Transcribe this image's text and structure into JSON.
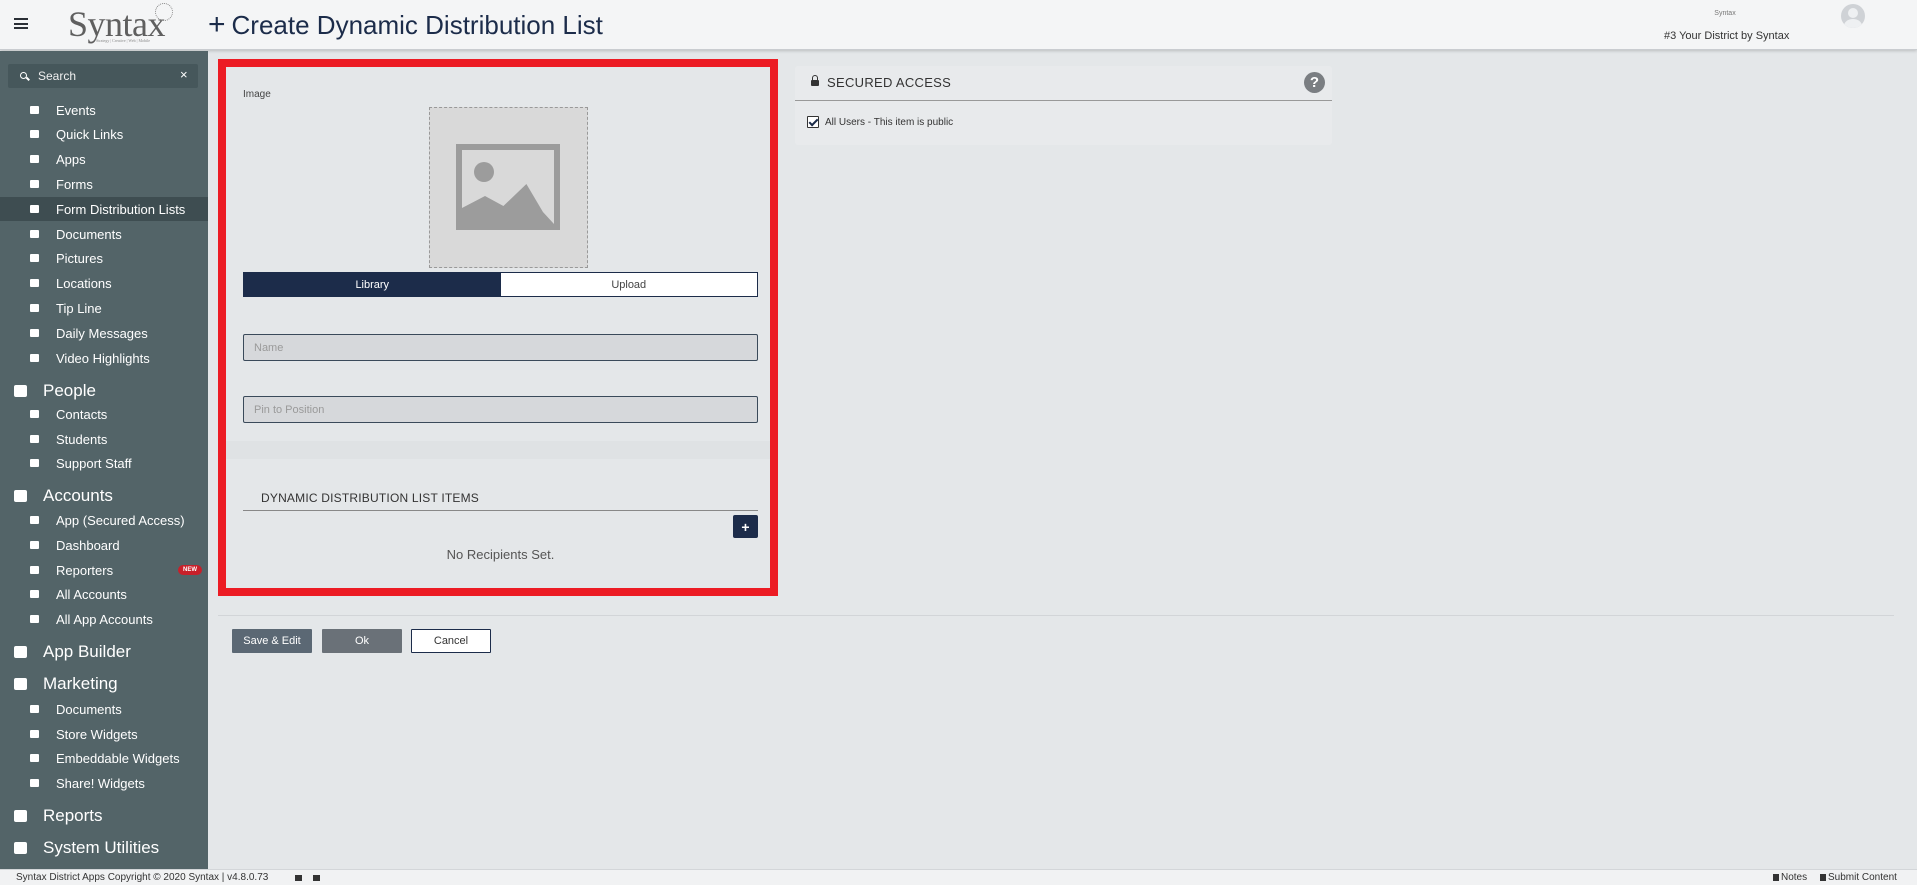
{
  "header": {
    "logo_text": "Syntax",
    "logo_tagline": "Strategy | Creative | Web | Mobile",
    "page_title_icon": "+",
    "page_title": "Create Dynamic Distribution List",
    "user_name": "Syntax",
    "district_label": "#3 Your District by Syntax"
  },
  "sidebar": {
    "search_placeholder": "Search",
    "search_close": "×",
    "items_top": [
      {
        "label": "Events",
        "icon": "calendar-icon"
      },
      {
        "label": "Quick Links",
        "icon": "link-icon"
      },
      {
        "label": "Apps",
        "icon": "grid-icon"
      },
      {
        "label": "Forms",
        "icon": "clipboard-icon"
      },
      {
        "label": "Form Distribution Lists",
        "icon": "list-icon",
        "active": true
      },
      {
        "label": "Documents",
        "icon": "document-icon"
      },
      {
        "label": "Pictures",
        "icon": "picture-icon"
      },
      {
        "label": "Locations",
        "icon": "pin-icon"
      },
      {
        "label": "Tip Line",
        "icon": "chat-icon"
      },
      {
        "label": "Daily Messages",
        "icon": "calendar-icon"
      },
      {
        "label": "Video Highlights",
        "icon": "video-icon"
      }
    ],
    "people": {
      "label": "People",
      "items": [
        {
          "label": "Contacts",
          "icon": "users-icon"
        },
        {
          "label": "Students",
          "icon": "users-icon"
        },
        {
          "label": "Support Staff",
          "icon": "lifebuoy-icon"
        }
      ]
    },
    "accounts": {
      "label": "Accounts",
      "items": [
        {
          "label": "App (Secured Access)",
          "icon": "mobile-icon"
        },
        {
          "label": "Dashboard",
          "icon": "monitor-icon"
        },
        {
          "label": "Reporters",
          "icon": "users-icon",
          "badge": "NEW"
        },
        {
          "label": "All Accounts",
          "icon": "users-icon"
        },
        {
          "label": "All App Accounts",
          "icon": "users-icon"
        }
      ]
    },
    "app_builder": {
      "label": "App Builder"
    },
    "marketing": {
      "label": "Marketing",
      "items": [
        {
          "label": "Documents",
          "icon": "document-icon"
        },
        {
          "label": "Store Widgets",
          "icon": "store-icon"
        },
        {
          "label": "Embeddable Widgets",
          "icon": "copy-icon"
        },
        {
          "label": "Share! Widgets",
          "icon": "copy-icon"
        }
      ]
    },
    "reports": {
      "label": "Reports"
    },
    "system_utilities": {
      "label": "System Utilities"
    }
  },
  "form": {
    "image_label": "Image",
    "library_label": "Library",
    "upload_label": "Upload",
    "name_placeholder": "Name",
    "pin_placeholder": "Pin to Position",
    "distribution_heading": "DYNAMIC DISTRIBUTION LIST ITEMS",
    "add_label": "+",
    "no_recipients": "No Recipients Set."
  },
  "secured_access": {
    "title": "SECURED ACCESS",
    "help": "?",
    "all_users_label": "All Users - This item is public"
  },
  "actions": {
    "save_edit": "Save & Edit",
    "ok": "Ok",
    "cancel": "Cancel"
  },
  "footer": {
    "copyright": "Syntax District Apps Copyright © 2020 Syntax | v4.8.0.73",
    "notes": "Notes",
    "submit_content": "Submit Content"
  },
  "colors": {
    "sidebar_bg": "#536468",
    "navy": "#1c2c4a",
    "highlight_red": "#ec1c24"
  }
}
